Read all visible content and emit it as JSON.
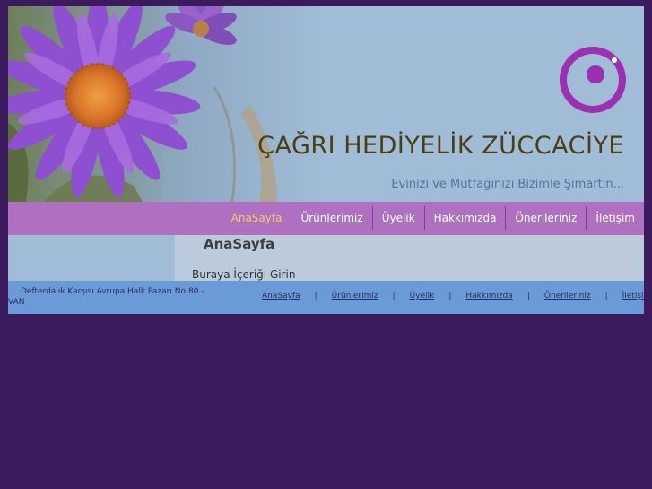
{
  "header": {
    "title": "ÇAĞRI HEDİYELİK ZÜCCACİYE",
    "slogan": "Evinizi ve Mutfağınızı Bizimle Şımartın...",
    "logo_icon": "circle-eye-logo-icon",
    "banner_icon": "purple-aster-flower-icon"
  },
  "nav": {
    "items": [
      {
        "label": "AnaSayfa",
        "active": true
      },
      {
        "label": "Ürünlerimiz",
        "active": false
      },
      {
        "label": "Üyelik",
        "active": false
      },
      {
        "label": "Hakkımızda",
        "active": false
      },
      {
        "label": "Önerileriniz",
        "active": false
      },
      {
        "label": "İletişim",
        "active": false
      }
    ]
  },
  "content": {
    "heading": "AnaSayfa",
    "body": "Buraya İçeriği Girin"
  },
  "footer": {
    "address": "Defterdalık Karşısı Avrupa Halk Pazarı No:80 - VAN",
    "links": [
      "AnaSayfa",
      "Ürünlerimiz",
      "Üyelik",
      "Hakkımızda",
      "Önerileriniz",
      "İletişim"
    ],
    "separator": "|"
  },
  "colors": {
    "background": "#3b1a5e",
    "header": "#a1bcd6",
    "nav": "#b070c2",
    "nav_active": "#f5c57a",
    "content": "#bccbdc",
    "footer": "#6b9ad9",
    "logo": "#9b30b0"
  }
}
